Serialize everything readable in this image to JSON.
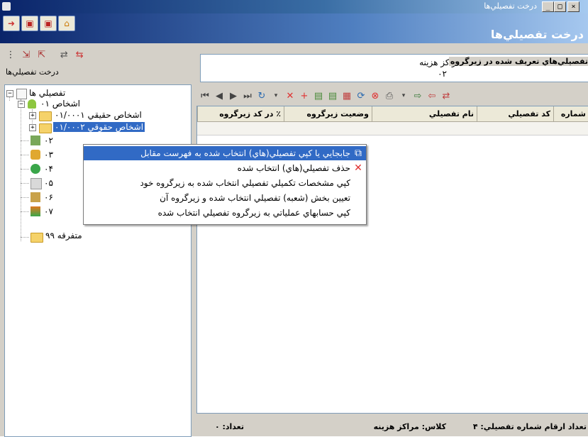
{
  "window": {
    "title": "درخت تفصيلي‌ها",
    "min_label": "_",
    "max_label": "□",
    "close_label": "×"
  },
  "header": {
    "title": "درخت تفصيلي‌ها"
  },
  "left_panel": {
    "label": "درخت تفصيلي‌ها"
  },
  "subgroup": {
    "label": "تفصيلي‌هاي تعريف شده در زيرگروه",
    "value": "مراكز هزينه",
    "code": "۰۲"
  },
  "tree": {
    "root": "تفصيلي ها",
    "nodes": [
      {
        "label": "اشخاص  ۰۱"
      },
      {
        "label": "اشخاص حقيقي  ۰۱/۰۰۰۱"
      },
      {
        "label": "اشخاص حقوقي  ۰۱/۰۰۰۲"
      },
      {
        "label": "۰۲"
      },
      {
        "label": "۰۳"
      },
      {
        "label": "۰۴"
      },
      {
        "label": "۰۵"
      },
      {
        "label": "۰۶"
      },
      {
        "label": "۰۷"
      },
      {
        "label": "متفرقه  ۹۹"
      }
    ]
  },
  "context_menu": {
    "items": [
      {
        "label": "جابجايي يا كپي تفصيلي(هاي) انتخاب شده به فهرست مقابل",
        "icon": "copy-icon"
      },
      {
        "label": "حذف تفصيلي(هاي) انتخاب شده",
        "icon": "delete-icon"
      },
      {
        "label": "كپي مشخصات تكميلي تفصيلي انتخاب شده به زيرگروه خود",
        "icon": ""
      },
      {
        "label": "تعيين بخش (شعبه) تفصيلي انتخاب شده و زيرگروه آن",
        "icon": ""
      },
      {
        "label": "كپي حسابهاي عملياتي به زيرگروه تفصيلي انتخاب شده",
        "icon": ""
      }
    ]
  },
  "grid": {
    "columns": [
      "شماره",
      "كد تفصيلي",
      "نام تفصيلي",
      "وضعيت زيرگروه",
      "٪ در كد زيرگروه"
    ]
  },
  "status": {
    "digits": "تعداد ارقام شماره تفصيلي: ۴",
    "class": "كلاس:  مراكز هزينه",
    "count": "تعداد: ۰"
  },
  "colors": {
    "highlight": "#316ac5",
    "titlebar": "#0a246a",
    "panel": "#d4d0c8"
  }
}
